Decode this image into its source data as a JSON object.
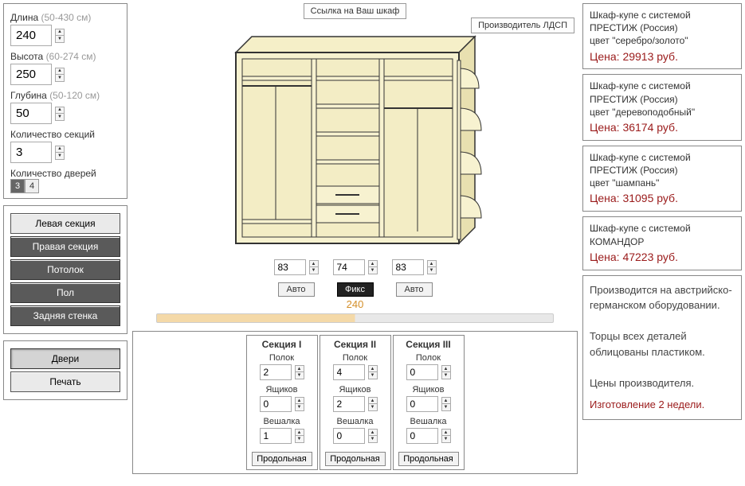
{
  "top": {
    "link_chip": "Ссылка на Ваш шкаф",
    "manufacturer_chip": "Производитель ЛДСП"
  },
  "params": {
    "length_label": "Длина",
    "length_hint": "(50-430 см)",
    "length_value": "240",
    "height_label": "Высота",
    "height_hint": "(60-274 см)",
    "height_value": "250",
    "depth_label": "Глубина",
    "depth_hint": "(50-120 см)",
    "depth_value": "50",
    "sections_label": "Количество секций",
    "sections_value": "3",
    "doors_label": "Количество дверей",
    "door_options": [
      "3",
      "4"
    ],
    "door_selected": "3"
  },
  "components": {
    "left_section": "Левая секция",
    "right_section": "Правая секция",
    "ceiling": "Потолок",
    "floor": "Пол",
    "back_wall": "Задняя стенка"
  },
  "actions": {
    "doors": "Двери",
    "print": "Печать"
  },
  "section_widths": {
    "s1": "83",
    "s2": "74",
    "s3": "83",
    "mode_auto": "Авто",
    "mode_fixed": "Фикс",
    "total": "240"
  },
  "sections": {
    "headers": [
      "Секция I",
      "Секция II",
      "Секция III"
    ],
    "shelf_label": "Полок",
    "drawer_label": "Ящиков",
    "hanger_label": "Вешалка",
    "longitudinal": "Продольная",
    "items": [
      {
        "shelves": "2",
        "drawers": "0",
        "hanger": "1"
      },
      {
        "shelves": "4",
        "drawers": "2",
        "hanger": "0"
      },
      {
        "shelves": "0",
        "drawers": "0",
        "hanger": "0"
      }
    ]
  },
  "prices": [
    {
      "title": "Шкаф-купе с системой ПРЕСТИЖ (Россия)",
      "variant": "цвет \"серебро/золото\"",
      "price": "Цена: 29913 руб."
    },
    {
      "title": "Шкаф-купе с системой ПРЕСТИЖ (Россия)",
      "variant": "цвет \"деревоподобный\"",
      "price": "Цена: 36174 руб."
    },
    {
      "title": "Шкаф-купе с системой ПРЕСТИЖ (Россия)",
      "variant": "цвет \"шампань\"",
      "price": "Цена: 31095 руб."
    },
    {
      "title": "Шкаф-купе с системой КОМАНДОР",
      "variant": "",
      "price": "Цена: 47223 руб."
    }
  ],
  "info": {
    "line1": "Производится на австрийско-германском оборудовании.",
    "line2": "Торцы всех деталей облицованы пластиком.",
    "line3": "Цены производителя.",
    "availability": "Изготовление 2 недели."
  }
}
